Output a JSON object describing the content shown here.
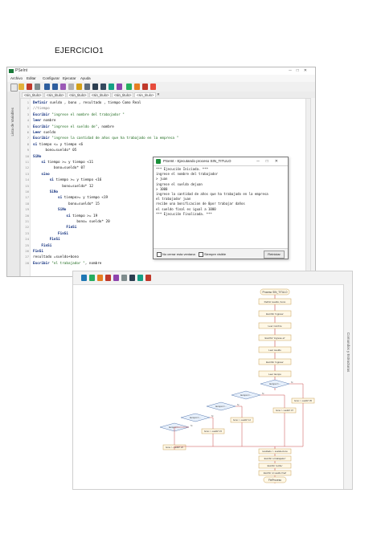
{
  "doc": {
    "heading": "EJERCICIO1"
  },
  "ide": {
    "title": "PSeInt",
    "menu": [
      "Archivo",
      "Editar",
      "Configurar",
      "Ejecutar",
      "Ayuda"
    ],
    "side_label": "Lista de Variables",
    "tabs": [
      "<sin_titulo>",
      "<sin_titulo>",
      "<sin_titulo>",
      "<sin_titulo>",
      "<sin_titulo>",
      "<sin_titulo>"
    ],
    "code": [
      {
        "n": "1",
        "kw": "Definir",
        "rest": " sueldo , bono , resultado , tiempo Como Real"
      },
      {
        "n": "2",
        "cm": "//tiempo"
      },
      {
        "n": "3",
        "kw": "Escribir",
        "st": " \"ingrese el nombre del trabajador \""
      },
      {
        "n": "4",
        "kw": "leer",
        "rest": " nombre"
      },
      {
        "n": "5",
        "kw": "Escribir",
        "st": " \"ingrese el sueldo de\"",
        "rest": ", nombre"
      },
      {
        "n": "6",
        "kw": "Leer",
        "rest": " sueldo"
      },
      {
        "n": "7",
        "kw": "Escribir",
        "st": " \"ingrese la cantidad de años que ha trabajado en la empresa \""
      },
      {
        "n": "8",
        "kw": "si",
        "rest": " tiempo <= y tiempo <6"
      },
      {
        "n": "9",
        "rest": "      bono=sueldo* 05"
      },
      {
        "n": "10",
        "kw": "SiNo"
      },
      {
        "n": "11",
        "kw": "    si",
        "rest": " tiempo >= y tiempo <11"
      },
      {
        "n": "12",
        "rest": "          bono=sueldo* 07"
      },
      {
        "n": "13",
        "kw": "    sino"
      },
      {
        "n": "14",
        "kw": "        si",
        "rest": " tiempo >= y tiempo <16"
      },
      {
        "n": "15",
        "rest": "              bono=sueldo* 12"
      },
      {
        "n": "16",
        "kw": "        SiNo"
      },
      {
        "n": "17",
        "kw": "            si",
        "rest": " tiempo>= y tiempo <19"
      },
      {
        "n": "18",
        "rest": "                 bono=sueldo* 15"
      },
      {
        "n": "19",
        "kw": "            SiNo"
      },
      {
        "n": "20",
        "kw": "                si",
        "rest": " tiempo >= 19"
      },
      {
        "n": "21",
        "rest": "                     bono= sueldo* 20"
      },
      {
        "n": "22",
        "kw": "                FinSi"
      },
      {
        "n": "23",
        "kw": "            FinSi"
      },
      {
        "n": "24",
        "kw": "        FinSi"
      },
      {
        "n": "25",
        "kw": "    FinSi"
      },
      {
        "n": "26",
        "kw": "FinSi"
      },
      {
        "n": "27",
        "rest": "resultado =sueldo+bono"
      },
      {
        "n": "28",
        "kw": "Escribir",
        "st": " \"el trabajador \"",
        "rest": ", nombre"
      }
    ]
  },
  "console": {
    "title": "PSeInt - Ejecutando proceso SIN_TITULO",
    "lines": [
      "*** Ejecución Iniciada. ***",
      "ingrese el nombre del trabajador",
      "> juan",
      "ingrese el sueldo dejuan",
      "> 1000",
      "ingrese la cantidad de años que ha trabajado en la empresa",
      "el trabajador juan",
      "recibe una bonificacion de 0por trabajar daños",
      "el sueldo final es igual a 1000",
      "*** Ejecución Finalizada. ***"
    ],
    "opt_no_close": "No cerrar esta ventana",
    "opt_always_visible": "Siempre visible",
    "restart_button": "Reiniciar"
  },
  "flow": {
    "side_label": "Comandos y Estructuras",
    "start": "Proceso SIN_TITULO",
    "steps": [
      "Definir sueldo, bono",
      "Escribir 'ingrese'",
      "Leer nombre",
      "Escribir 'ingrese el'",
      "Leer sueldo",
      "Escribir 'ingrese'",
      "Leer tiempo"
    ],
    "decisions": [
      "tiempo<=...",
      "tiempo>=...",
      "tiempo>=...",
      "tiempo>=...",
      "tiempo>=..."
    ],
    "assigns": [
      "bono <- sueldo*.05",
      "bono <- sueldo*.07",
      "bono <- sueldo*.12",
      "bono <- sueldo*.15",
      "bono <- sueldo*.20"
    ],
    "tail": [
      "resultado <- sueldo+bono",
      "Escribir 'el trabajador'",
      "Escribir 'recibe'",
      "Escribir 'el sueldo final'"
    ],
    "end": "FinProceso",
    "si_label": "Si",
    "no_label": "No"
  },
  "colors": {
    "keyword": "#0b2a7a",
    "string": "#1f6b1f",
    "comment": "#7a7a7a",
    "flow_box_fill": "#fff8e6",
    "flow_box_stroke": "#c8a25a",
    "flow_line": "#c84a4a",
    "flow_decision_fill": "#e7f0fb"
  }
}
